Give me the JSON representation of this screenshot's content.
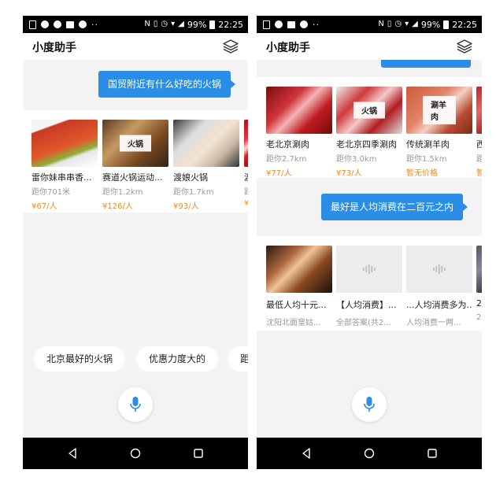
{
  "status_bar": {
    "battery": "99%",
    "time": "22:25",
    "dots": "··"
  },
  "app": {
    "title": "小度助手"
  },
  "left": {
    "user_message": "国贸附近有什么好吃的火锅",
    "cards": [
      {
        "name": "雷你妹串串香...",
        "sub": "距你701米",
        "price": "¥67/人",
        "tag": ""
      },
      {
        "name": "赛道火锅运动...",
        "sub": "距你1.2km",
        "price": "¥126/人",
        "tag": "火锅"
      },
      {
        "name": "渡娘火锅",
        "sub": "距你1.7km",
        "price": "¥93/人",
        "tag": ""
      },
      {
        "name": "渡",
        "sub": "距",
        "price": "¥",
        "tag": ""
      }
    ],
    "suggestions": [
      "北京最好的火锅",
      "优惠力度大的",
      "距"
    ]
  },
  "right": {
    "cards_top": [
      {
        "name": "老北京涮肉",
        "sub": "距你2.7km",
        "price": "¥77/人",
        "tag": ""
      },
      {
        "name": "老北京四季涮肉",
        "sub": "距你3.0km",
        "price": "¥73/人",
        "tag": "火锅"
      },
      {
        "name": "传统涮羊肉",
        "sub": "距你1.5km",
        "price": "暂无价格",
        "tag": "涮羊肉"
      },
      {
        "name": "西",
        "sub": "距",
        "price": "暂",
        "tag": ""
      }
    ],
    "user_message": "最好是人均消费在二百元之内",
    "cards_bottom": [
      {
        "name": "最低人均十元...",
        "sub": "沈阳北面皇姑..."
      },
      {
        "name": "【人均消费】...",
        "sub": "全部答案(共2..."
      },
      {
        "name": "...人均消费多为...",
        "sub": "人均消费一两..."
      },
      {
        "name": "2",
        "sub": "2"
      }
    ]
  },
  "colors": {
    "accent": "#2a8de6",
    "price": "#f08a1c",
    "bg": "#f3f3f3"
  }
}
